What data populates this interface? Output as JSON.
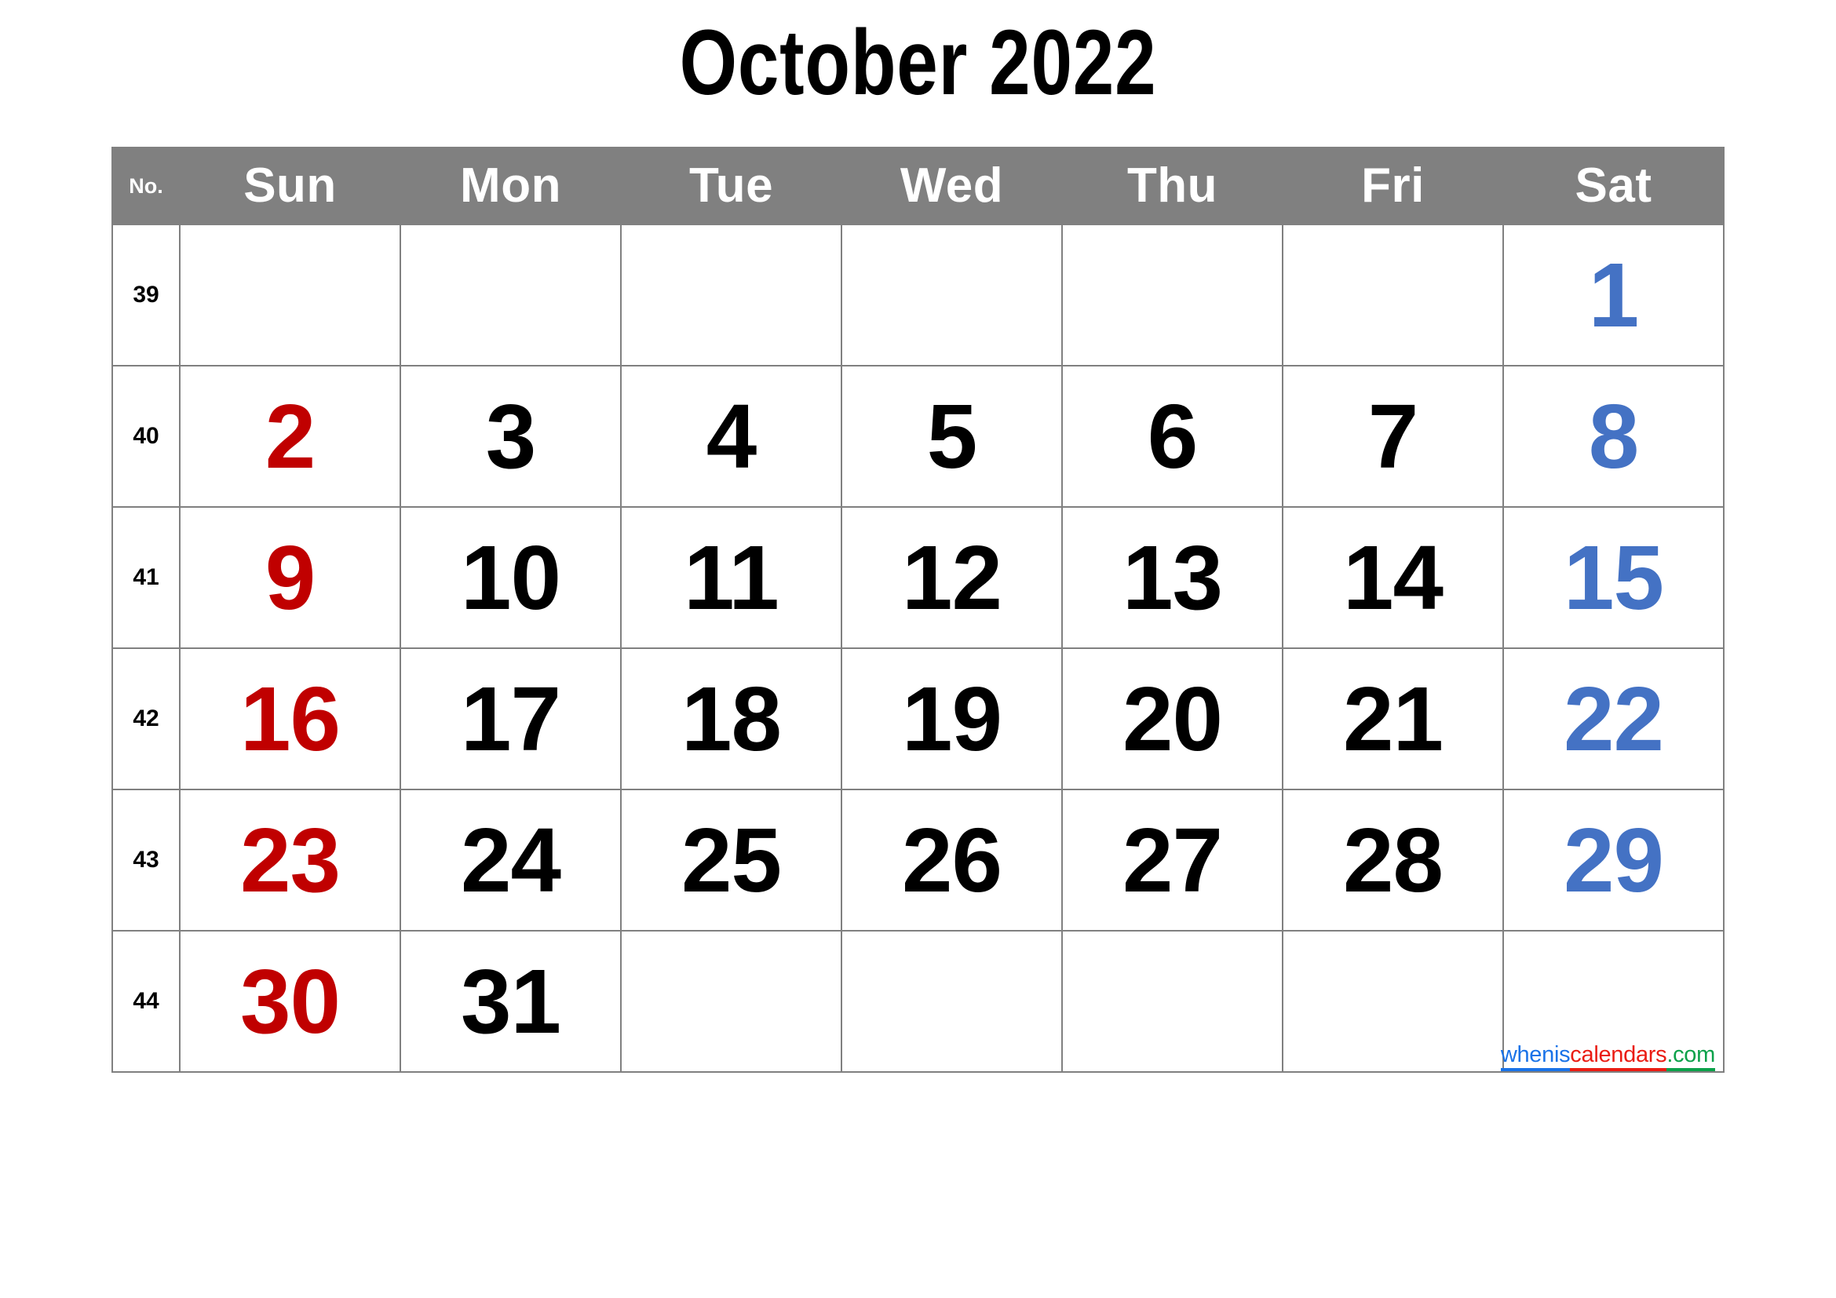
{
  "title": "October 2022",
  "colors": {
    "header_background": "#808080",
    "header_text": "#FFFFFF",
    "grid_line": "#808080",
    "sunday": "#C00000",
    "saturday": "#4472C4",
    "weekday": "#000000",
    "page_background": "#FFFFFF"
  },
  "table": {
    "week_column_header": "No.",
    "day_headers": [
      "Sun",
      "Mon",
      "Tue",
      "Wed",
      "Thu",
      "Fri",
      "Sat"
    ],
    "weeks": [
      {
        "no": "39",
        "days": [
          "",
          "",
          "",
          "",
          "",
          "",
          "1"
        ]
      },
      {
        "no": "40",
        "days": [
          "2",
          "3",
          "4",
          "5",
          "6",
          "7",
          "8"
        ]
      },
      {
        "no": "41",
        "days": [
          "9",
          "10",
          "11",
          "12",
          "13",
          "14",
          "15"
        ]
      },
      {
        "no": "42",
        "days": [
          "16",
          "17",
          "18",
          "19",
          "20",
          "21",
          "22"
        ]
      },
      {
        "no": "43",
        "days": [
          "23",
          "24",
          "25",
          "26",
          "27",
          "28",
          "29"
        ]
      },
      {
        "no": "44",
        "days": [
          "30",
          "31",
          "",
          "",
          "",
          "",
          ""
        ]
      }
    ]
  },
  "watermark": {
    "part1": "whenis",
    "part2": "calendars",
    "part3": ".com",
    "part1_color": "#1A73E8",
    "part2_color": "#EA1C13",
    "part3_color": "#0CA14A"
  }
}
